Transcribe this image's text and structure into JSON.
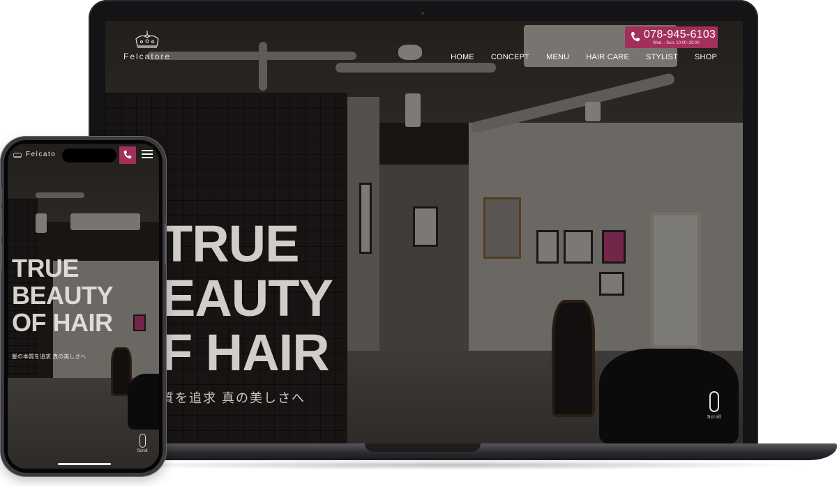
{
  "brand": {
    "name": "Felcatore",
    "mobile_name": "Felcato"
  },
  "header": {
    "phone_number": "078-945-6103",
    "phone_hours": "Wed. - Sun. 10:00~20:00",
    "nav": [
      "HOME",
      "CONCEPT",
      "MENU",
      "HAIR CARE",
      "STYLIST",
      "SHOP"
    ]
  },
  "hero": {
    "desktop_lines": [
      "TRUE",
      "EAUTY",
      "F HAIR"
    ],
    "desktop_subtitle": "質を追求 真の美しさへ",
    "mobile_lines": [
      "TRUE",
      "BEAUTY",
      "OF HAIR"
    ],
    "mobile_subtitle": "髪の本質を追求 真の美しさへ"
  },
  "scroll_label": "Scroll",
  "icons": {
    "logo": "crown-logo-icon",
    "phone": "phone-icon",
    "menu": "hamburger-menu-icon",
    "scroll": "mouse-scroll-icon"
  },
  "colors": {
    "accent": "#a2305b",
    "text_light": "#e8e4de"
  }
}
